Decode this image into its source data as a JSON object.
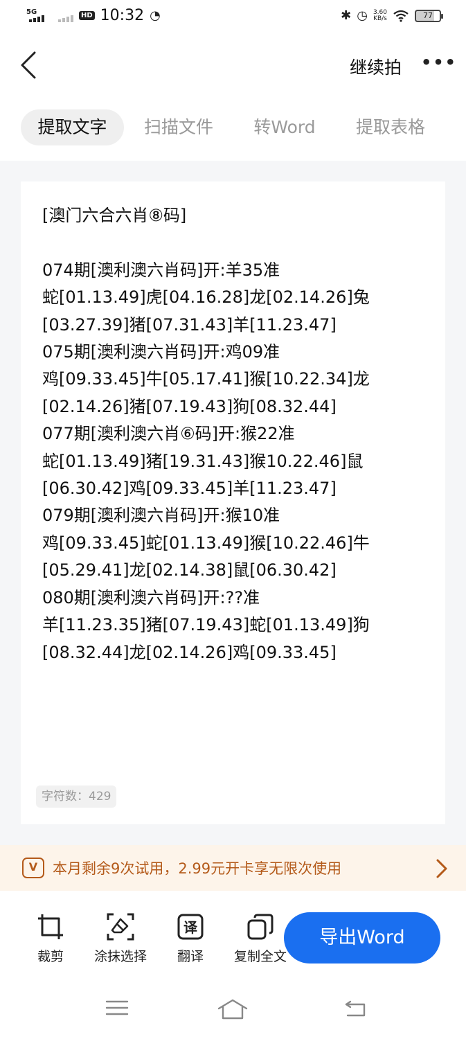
{
  "status_bar": {
    "network": "5G",
    "hd_badge": "HD",
    "time": "10:32",
    "net_speed_value": "3.60",
    "net_speed_unit": "KB/s",
    "battery": "77"
  },
  "header": {
    "retake_label": "继续拍"
  },
  "tabs": [
    {
      "label": "提取文字",
      "active": true
    },
    {
      "label": "扫描文件",
      "active": false
    },
    {
      "label": "转Word",
      "active": false
    },
    {
      "label": "提取表格",
      "active": false
    }
  ],
  "content": {
    "text": "[澳门六合六肖⑧码]\n\n074期[澳利澳六肖码]开:羊35准\n蛇[01.13.49]虎[04.16.28]龙[02.14.26]兔\n[03.27.39]猪[07.31.43]羊[11.23.47]\n075期[澳利澳六肖码]开:鸡09准\n鸡[09.33.45]牛[05.17.41]猴[10.22.34]龙\n[02.14.26]猪[07.19.43]狗[08.32.44]\n077期[澳利澳六肖⑥码]开:猴22准\n蛇[01.13.49]猪[19.31.43]猴10.22.46]鼠\n[06.30.42]鸡[09.33.45]羊[11.23.47]\n079期[澳利澳六肖码]开:猴10准\n鸡[09.33.45]蛇[01.13.49]猴[10.22.46]牛\n[05.29.41]龙[02.14.38]鼠[06.30.42]\n080期[澳利澳六肖码]开:??准\n羊[11.23.35]猪[07.19.43]蛇[01.13.49]狗\n[08.32.44]龙[02.14.26]鸡[09.33.45]",
    "char_count": "字符数：429"
  },
  "promo": {
    "badge": "V",
    "text": "本月剩余9次试用，2.99元开卡享无限次使用"
  },
  "toolbar": {
    "crop_label": "裁剪",
    "smear_label": "涂抹选择",
    "translate_label": "翻译",
    "translate_icon_char": "译",
    "copy_label": "复制全文",
    "export_label": "导出Word"
  },
  "colors": {
    "accent": "#1a6ff0",
    "promo_text": "#b45a1a",
    "promo_bg": "#fdf4ea",
    "page_bg": "#f5f6f8"
  }
}
